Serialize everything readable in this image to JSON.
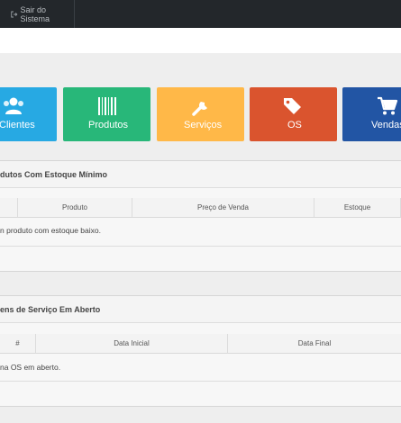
{
  "topbar": {
    "logout_label": "Sair do Sistema"
  },
  "tiles": [
    {
      "label": "Clientes",
      "icon": "users-icon",
      "color": "#27a9e3"
    },
    {
      "label": "Produtos",
      "icon": "barcode-icon",
      "color": "#28b779"
    },
    {
      "label": "Serviços",
      "icon": "wrench-icon",
      "color": "#ffb848"
    },
    {
      "label": "OS",
      "icon": "tags-icon",
      "color": "#da542e"
    },
    {
      "label": "Vendas",
      "icon": "cart-icon",
      "color": "#2255a4"
    }
  ],
  "stock_panel": {
    "title": "dutos Com Estoque Mínimo",
    "columns": [
      "Produto",
      "Preço de Venda",
      "Estoque"
    ],
    "empty_message": "n produto com estoque baixo."
  },
  "os_panel": {
    "title": "ens de Serviço Em Aberto",
    "columns": [
      "#",
      "Data Inicial",
      "Data Final"
    ],
    "empty_message": "na OS em aberto."
  }
}
